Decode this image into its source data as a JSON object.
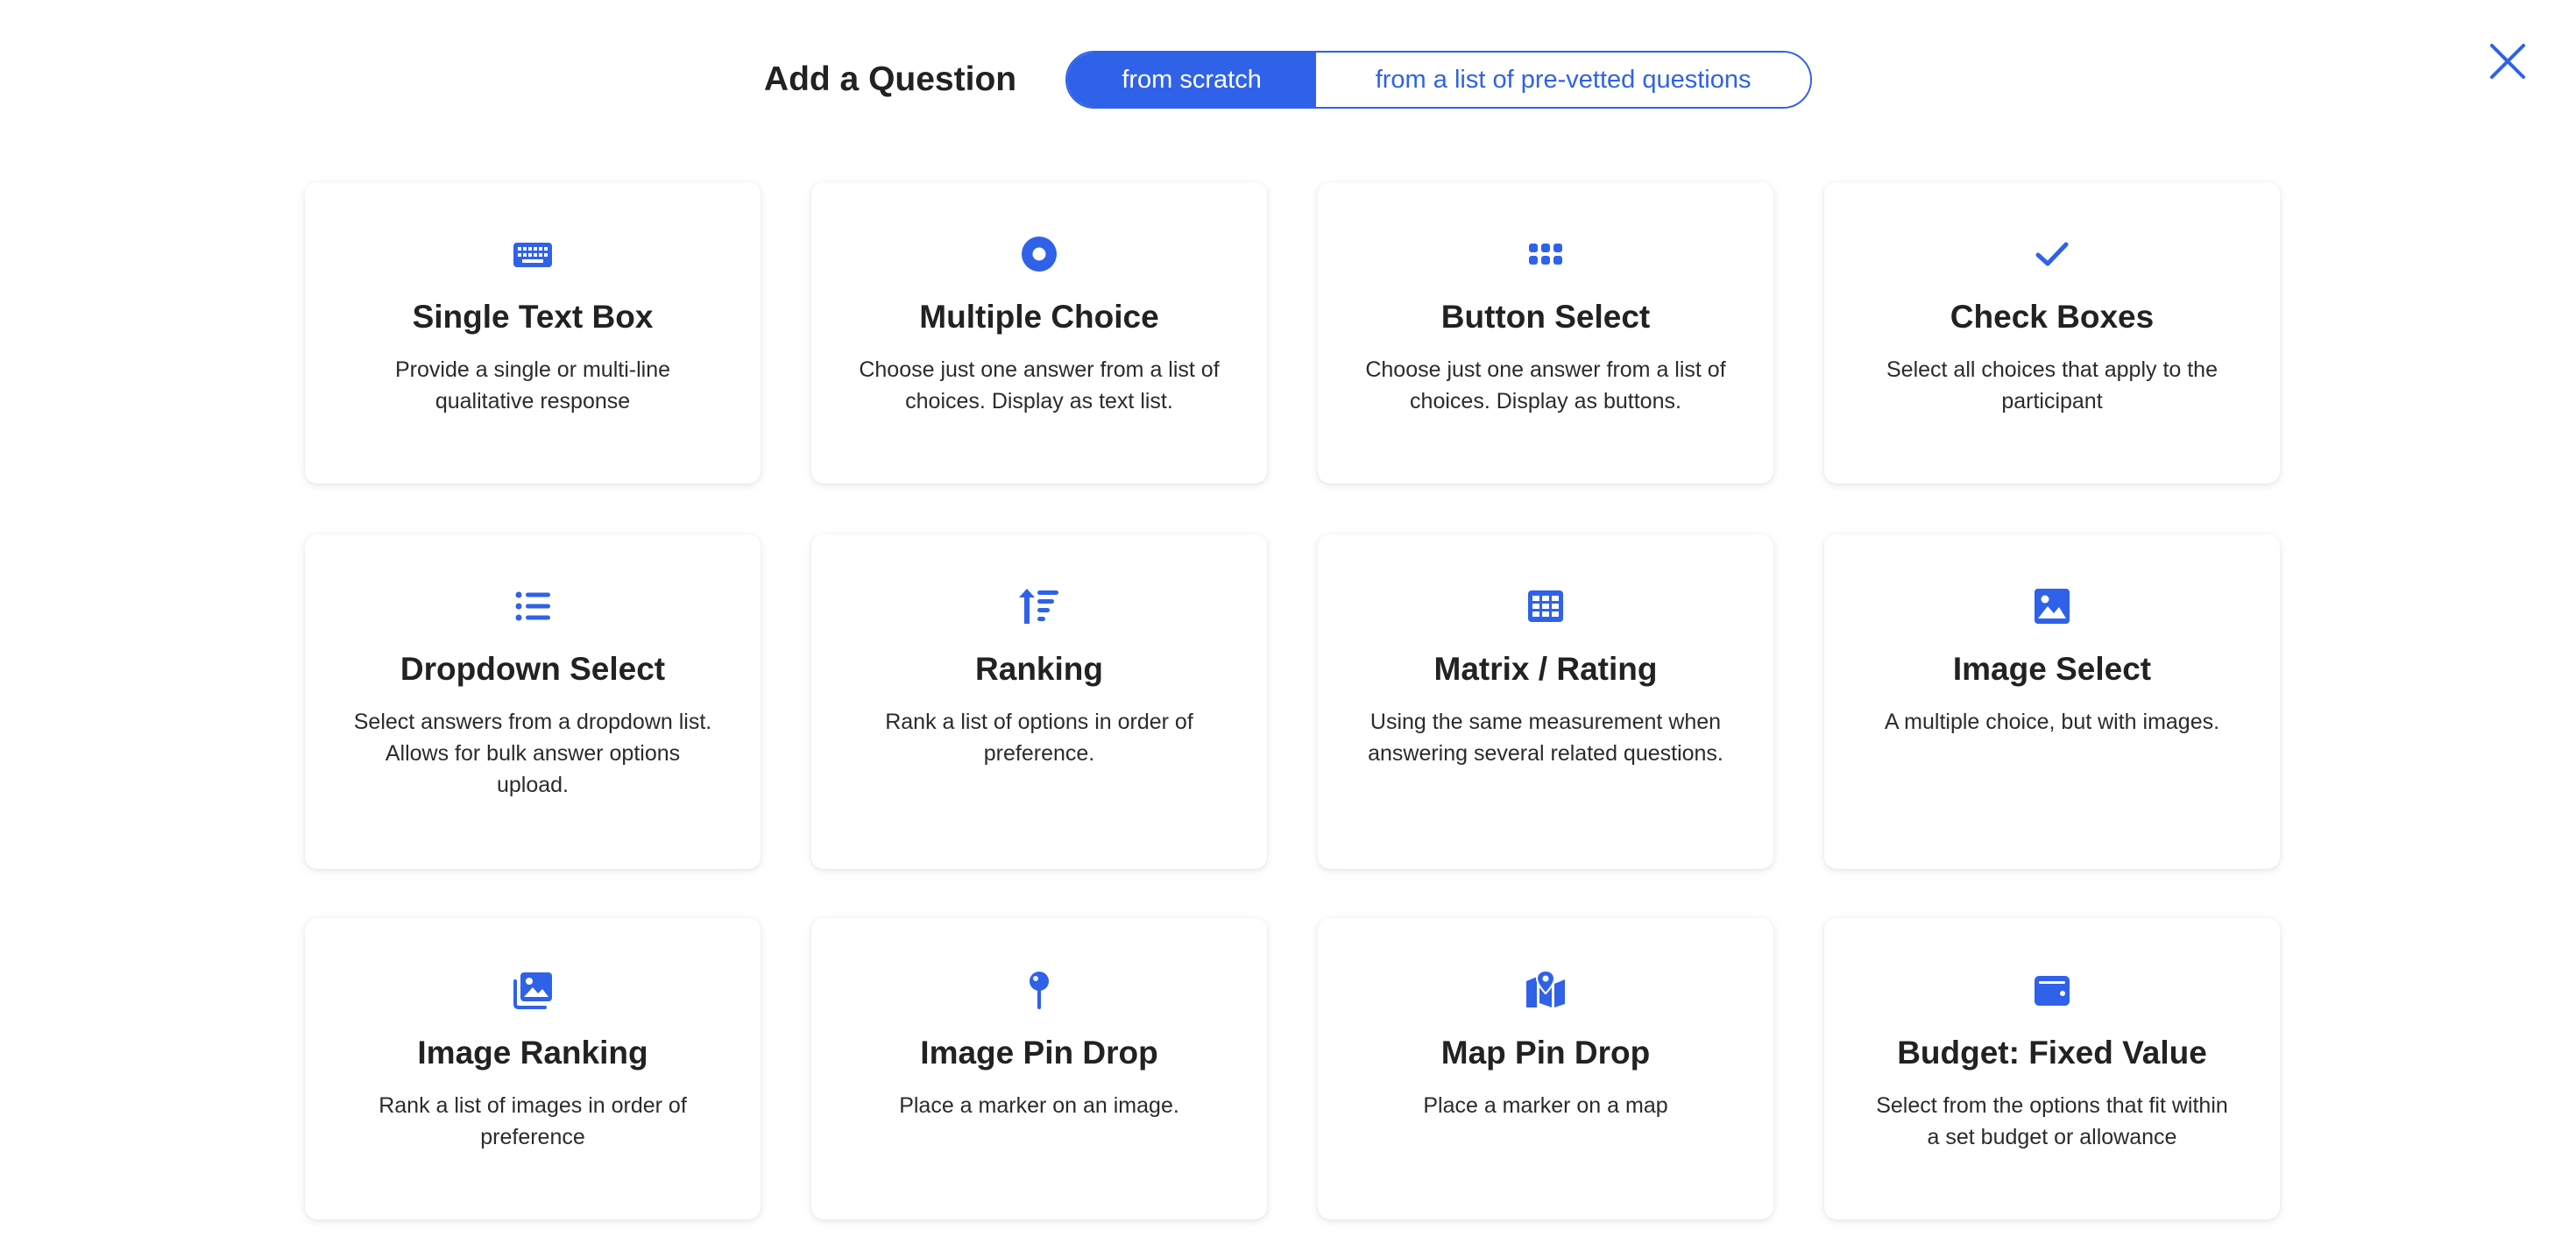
{
  "header": {
    "title": "Add a Question",
    "tabs": [
      {
        "label": "from scratch",
        "active": true
      },
      {
        "label": "from a list of pre-vetted questions",
        "active": false
      }
    ],
    "close_icon": "close-icon"
  },
  "accent_color": "#2f62e9",
  "cards": [
    {
      "icon": "keyboard-icon",
      "title": "Single Text Box",
      "description": "Provide a single or multi-line qualitative response"
    },
    {
      "icon": "radio-icon",
      "title": "Multiple Choice",
      "description": "Choose just one answer from a list of choices. Display as text list."
    },
    {
      "icon": "dots-grid-icon",
      "title": "Button Select",
      "description": "Choose just one answer from a list of choices. Display as buttons."
    },
    {
      "icon": "check-icon",
      "title": "Check Boxes",
      "description": "Select all choices that apply to the participant"
    },
    {
      "icon": "list-icon",
      "title": "Dropdown Select",
      "description": "Select answers from a dropdown list. Allows for bulk answer options upload."
    },
    {
      "icon": "sort-icon",
      "title": "Ranking",
      "description": "Rank a list of options in order of preference."
    },
    {
      "icon": "table-icon",
      "title": "Matrix / Rating",
      "description": "Using the same measurement when answering several related questions."
    },
    {
      "icon": "image-icon",
      "title": "Image Select",
      "description": "A multiple choice, but with images."
    },
    {
      "icon": "images-icon",
      "title": "Image Ranking",
      "description": "Rank a list of images in order of preference"
    },
    {
      "icon": "pin-icon",
      "title": "Image Pin Drop",
      "description": "Place a marker on an image."
    },
    {
      "icon": "map-icon",
      "title": "Map Pin Drop",
      "description": "Place a marker on a map"
    },
    {
      "icon": "wallet-icon",
      "title": "Budget: Fixed Value",
      "description": "Select from the options that fit within a set budget or allowance"
    }
  ]
}
